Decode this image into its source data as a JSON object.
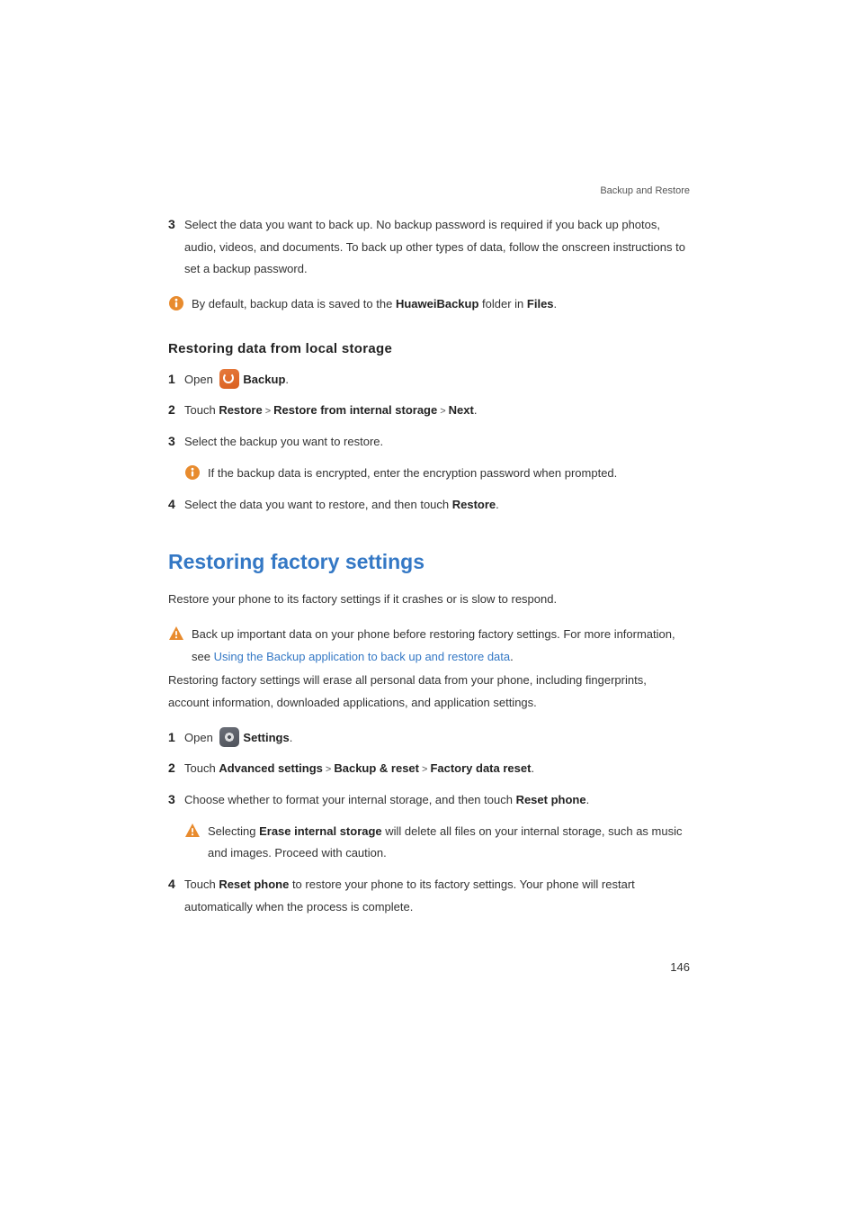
{
  "header": {
    "section": "Backup and Restore"
  },
  "top_steps": {
    "s3": {
      "num": "3",
      "text": "Select the data you want to back up. No backup password is required if you back up photos, audio, videos, and documents. To back up other types of data, follow the onscreen instructions to set a backup password."
    },
    "note": {
      "pre": "By default, backup data is saved to the ",
      "bold1": "HuaweiBackup",
      "mid": " folder in ",
      "bold2": "Files",
      "post": "."
    }
  },
  "restore_local": {
    "heading": "Restoring data from local storage",
    "s1": {
      "num": "1",
      "open": "Open ",
      "app": "Backup",
      "dot": "."
    },
    "s2": {
      "num": "2",
      "touch": "Touch ",
      "b1": "Restore",
      "b2": "Restore from internal storage",
      "b3": "Next",
      "dot": "."
    },
    "s3": {
      "num": "3",
      "text": "Select the backup you want to restore."
    },
    "note": {
      "text": "If the backup data is encrypted, enter the encryption password when prompted."
    },
    "s4": {
      "num": "4",
      "pre": "Select the data you want to restore, and then touch ",
      "b1": "Restore",
      "dot": "."
    }
  },
  "factory": {
    "heading": "Restoring factory settings",
    "intro": "Restore your phone to its factory settings if it crashes or is slow to respond.",
    "warn1": {
      "line1": "Back up important data on your phone before restoring factory settings. For more information, see ",
      "link": "Using the Backup application to back up and restore data",
      "linkdot": "."
    },
    "after_warn": "Restoring factory settings will erase all personal data from your phone, including fingerprints, account information, downloaded applications, and application settings.",
    "s1": {
      "num": "1",
      "open": "Open ",
      "app": "Settings",
      "dot": "."
    },
    "s2": {
      "num": "2",
      "touch": "Touch ",
      "b1": "Advanced settings",
      "b2": "Backup & reset",
      "b3": "Factory data reset",
      "dot": "."
    },
    "s3": {
      "num": "3",
      "pre": "Choose whether to format your internal storage, and then touch ",
      "b1": "Reset phone",
      "dot": "."
    },
    "warn2": {
      "pre": "Selecting ",
      "b1": "Erase internal storage",
      "post": " will delete all files on your internal storage, such as music and images. Proceed with caution."
    },
    "s4": {
      "num": "4",
      "pre": "Touch ",
      "b1": "Reset phone",
      "post": " to restore your phone to its factory settings. Your phone will restart automatically when the process is complete."
    }
  },
  "page_number": "146"
}
